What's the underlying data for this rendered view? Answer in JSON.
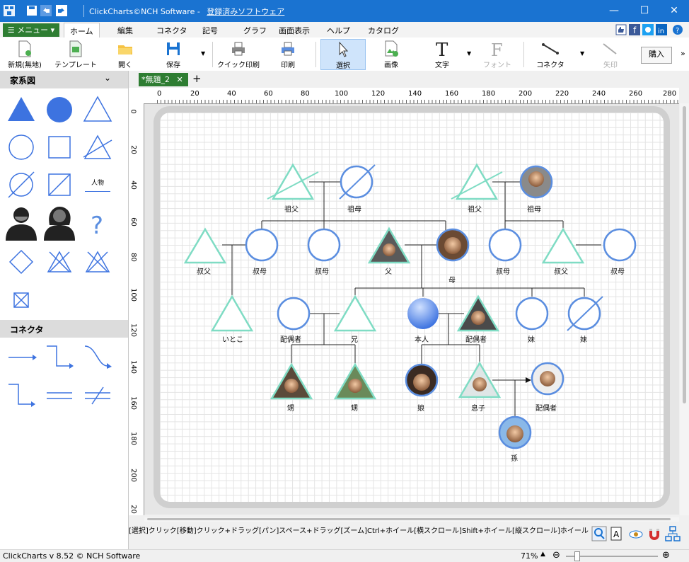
{
  "window": {
    "title": "ClickCharts©NCH Software - ",
    "title_link": "登録済みソフトウェア"
  },
  "menu": {
    "menu_button": "☰ メニュー ▾",
    "tabs": [
      "ホーム",
      "編集",
      "コネクタ",
      "記号",
      "グラフ",
      "画面表示",
      "ヘルプ",
      "カタログ"
    ]
  },
  "toolbar": {
    "new": "新規(無地)",
    "template": "テンプレート",
    "open": "開く",
    "save": "保存",
    "quick_print": "クイック印刷",
    "print": "印刷",
    "select": "選択",
    "image": "画像",
    "text": "文字",
    "font": "フォント",
    "connector": "コネクタ",
    "arrow": "矢印",
    "buy": "購入"
  },
  "left_panel": {
    "family_header": "家系図",
    "connector_header": "コネクタ",
    "person_label": "人物"
  },
  "document": {
    "tab_name": "*無題_2",
    "add_tab": "+"
  },
  "rulers": {
    "top": [
      "0",
      "20",
      "40",
      "60",
      "80",
      "100",
      "120",
      "140",
      "160",
      "180",
      "200",
      "220",
      "240",
      "260",
      "280"
    ],
    "left": [
      "0",
      "20",
      "40",
      "60",
      "80",
      "100",
      "120",
      "140",
      "160",
      "180",
      "200",
      "20"
    ]
  },
  "diagram": {
    "labels": {
      "gf1": "祖父",
      "gm1": "祖母",
      "gf2": "祖父",
      "gm2": "祖母",
      "uncle1": "叔父",
      "aunt1": "叔母",
      "aunt2": "叔母",
      "father": "父",
      "mother": "母",
      "aunt3": "叔母",
      "uncle2": "叔父",
      "aunt4": "叔母",
      "cousin": "いとこ",
      "spouse_bro": "配偶者",
      "brother": "兄",
      "self": "本人",
      "spouse": "配偶者",
      "sister1": "妹",
      "sister2": "妹",
      "nephew1": "甥",
      "nephew2": "甥",
      "daughter": "娘",
      "son": "息子",
      "son_spouse": "配偶者",
      "grandchild": "孫"
    }
  },
  "hint": "[選択]クリック[移動]クリック+ドラッグ[パン]スペース+ドラッグ[ズーム]Ctrl+ホイール[横スクロール]Shift+ホイール[縦スクロール]ホイール",
  "status": {
    "version": "ClickCharts v 8.52 © NCH Software",
    "zoom": "71%"
  },
  "colors": {
    "titlebar": "#1a73d1",
    "accent_green": "#2e7d32",
    "male_teal": "#7fdcc4",
    "female_blue": "#5b8ee0"
  }
}
